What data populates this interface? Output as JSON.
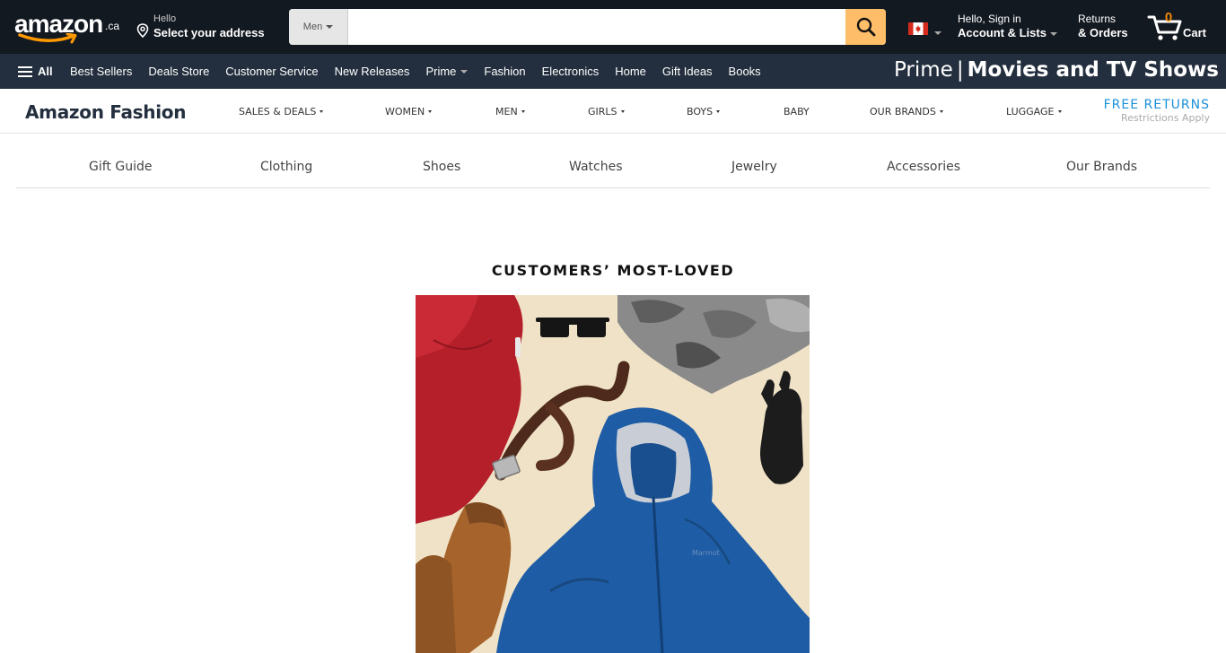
{
  "header": {
    "logo_text": "amazon",
    "logo_tld": ".ca",
    "address_greeting": "Hello",
    "address_action": "Select your address",
    "search": {
      "category": "Men",
      "placeholder": "",
      "value": ""
    },
    "account_greeting": "Hello, Sign in",
    "account_label": "Account & Lists",
    "returns_line1": "Returns",
    "returns_line2": "& Orders",
    "cart_count": "0",
    "cart_label": "Cart",
    "accent": "#febd69",
    "cart_count_color": "#f08804"
  },
  "navbar": {
    "all_label": "All",
    "items": [
      {
        "label": "Best Sellers",
        "dropdown": false
      },
      {
        "label": "Deals Store",
        "dropdown": false
      },
      {
        "label": "Customer Service",
        "dropdown": false
      },
      {
        "label": "New Releases",
        "dropdown": false
      },
      {
        "label": "Prime",
        "dropdown": true
      },
      {
        "label": "Fashion",
        "dropdown": false
      },
      {
        "label": "Electronics",
        "dropdown": false
      },
      {
        "label": "Home",
        "dropdown": false
      },
      {
        "label": "Gift Ideas",
        "dropdown": false
      },
      {
        "label": "Books",
        "dropdown": false
      }
    ],
    "promo_prefix": "Prime",
    "promo_separator": "|",
    "promo_main": "Movies and TV Shows"
  },
  "fashion_nav": {
    "title": "Amazon Fashion",
    "items": [
      {
        "label": "SALES & DEALS",
        "dropdown": true
      },
      {
        "label": "WOMEN",
        "dropdown": true
      },
      {
        "label": "MEN",
        "dropdown": true
      },
      {
        "label": "GIRLS",
        "dropdown": true
      },
      {
        "label": "BOYS",
        "dropdown": true
      },
      {
        "label": "BABY",
        "dropdown": false
      },
      {
        "label": "OUR BRANDS",
        "dropdown": true
      },
      {
        "label": "LUGGAGE",
        "dropdown": true
      }
    ],
    "free_returns": "FREE RETURNS",
    "free_returns_note": "Restrictions Apply"
  },
  "category_tabs": [
    "Gift Guide",
    "Clothing",
    "Shoes",
    "Watches",
    "Jewelry",
    "Accessories",
    "Our Brands"
  ],
  "content": {
    "section_heading": "CUSTOMERS’ MOST-LOVED",
    "hero_jacket_brand": "Marmot"
  }
}
